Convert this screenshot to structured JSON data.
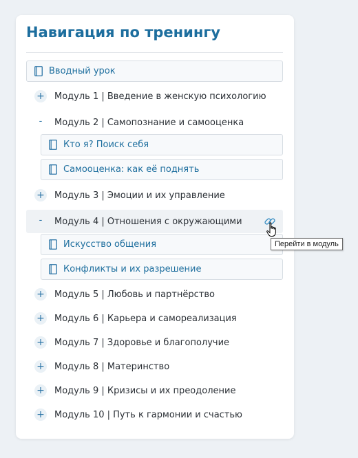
{
  "nav": {
    "title": "Навигация по тренингу",
    "intro_lesson": "Вводный урок",
    "modules": [
      {
        "label": "Модуль 1 | Введение в женскую психологию",
        "toggle": "+"
      },
      {
        "label": "Модуль 2 | Самопознание и самооценка",
        "toggle": "-",
        "lessons": [
          "Кто я? Поиск себя",
          "Самооценка: как её поднять"
        ]
      },
      {
        "label": "Модуль 3 | Эмоции и их управление",
        "toggle": "+"
      },
      {
        "label": "Модуль 4 | Отношения с окружающими",
        "toggle": "-",
        "lessons": [
          "Искусство общения",
          "Конфликты и их разрешение"
        ]
      },
      {
        "label": "Модуль 5 | Любовь и партнёрство",
        "toggle": "+"
      },
      {
        "label": "Модуль 6 | Карьера и самореализация",
        "toggle": "+"
      },
      {
        "label": "Модуль 7 | Здоровье и благополучие",
        "toggle": "+"
      },
      {
        "label": "Модуль 8 | Материнство",
        "toggle": "+"
      },
      {
        "label": "Модуль 9 | Кризисы и их преодоление",
        "toggle": "+"
      },
      {
        "label": "Модуль 10 | Путь к гармонии и счастью",
        "toggle": "+"
      }
    ],
    "link_icon": "link-icon",
    "tooltip": "Перейти в модуль"
  },
  "colors": {
    "accent": "#1d6e9e",
    "background": "#edf1f5",
    "card": "#ffffff",
    "lesson_bg": "#f7f9fb"
  }
}
